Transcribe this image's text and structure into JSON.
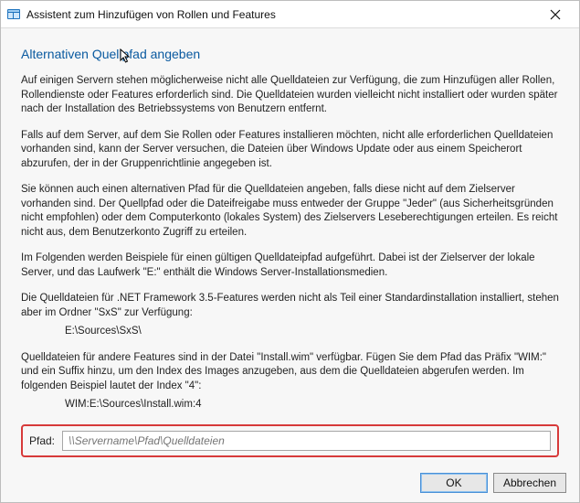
{
  "window": {
    "title": "Assistent zum Hinzufügen von Rollen und Features"
  },
  "heading": "Alternativen Quellpfad angeben",
  "paragraphs": {
    "p1": "Auf einigen Servern stehen möglicherweise nicht alle Quelldateien zur Verfügung, die zum Hinzufügen aller Rollen, Rollendienste oder Features erforderlich sind. Die Quelldateien wurden vielleicht nicht installiert oder wurden später nach der Installation des Betriebssystems von Benutzern entfernt.",
    "p2": "Falls auf dem Server, auf dem Sie Rollen oder Features installieren möchten, nicht alle erforderlichen Quelldateien vorhanden sind, kann der Server versuchen, die Dateien über Windows Update oder aus einem Speicherort abzurufen, der in der Gruppenrichtlinie angegeben ist.",
    "p3": "Sie können auch einen alternativen Pfad für die Quelldateien angeben, falls diese nicht auf dem Zielserver vorhanden sind. Der Quellpfad oder die Dateifreigabe muss entweder der Gruppe \"Jeder\" (aus Sicherheitsgründen nicht empfohlen) oder dem Computerkonto (lokales System) des Zielservers Leseberechtigungen erteilen. Es reicht nicht aus, dem Benutzerkonto Zugriff zu erteilen.",
    "p4": "Im Folgenden werden Beispiele für einen gültigen Quelldateipfad aufgeführt. Dabei ist der Zielserver der lokale Server, und das Laufwerk \"E:\" enthält die Windows Server-Installationsmedien.",
    "p5": "Die Quelldateien für .NET Framework 3.5-Features werden nicht als Teil einer Standardinstallation installiert, stehen aber im Ordner \"SxS\" zur Verfügung:",
    "p5_example": "E:\\Sources\\SxS\\",
    "p6": "Quelldateien für andere Features sind in der Datei \"Install.wim\" verfügbar. Fügen Sie dem Pfad das Präfix \"WIM:\" und ein Suffix hinzu, um den Index des Images anzugeben, aus dem die Quelldateien abgerufen werden. Im folgenden Beispiel lautet der Index \"4\":",
    "p6_example": "WIM:E:\\Sources\\Install.wim:4"
  },
  "path": {
    "label": "Pfad:",
    "placeholder": "\\\\Servername\\Pfad\\Quelldateien",
    "value": ""
  },
  "buttons": {
    "ok": "OK",
    "cancel": "Abbrechen"
  }
}
